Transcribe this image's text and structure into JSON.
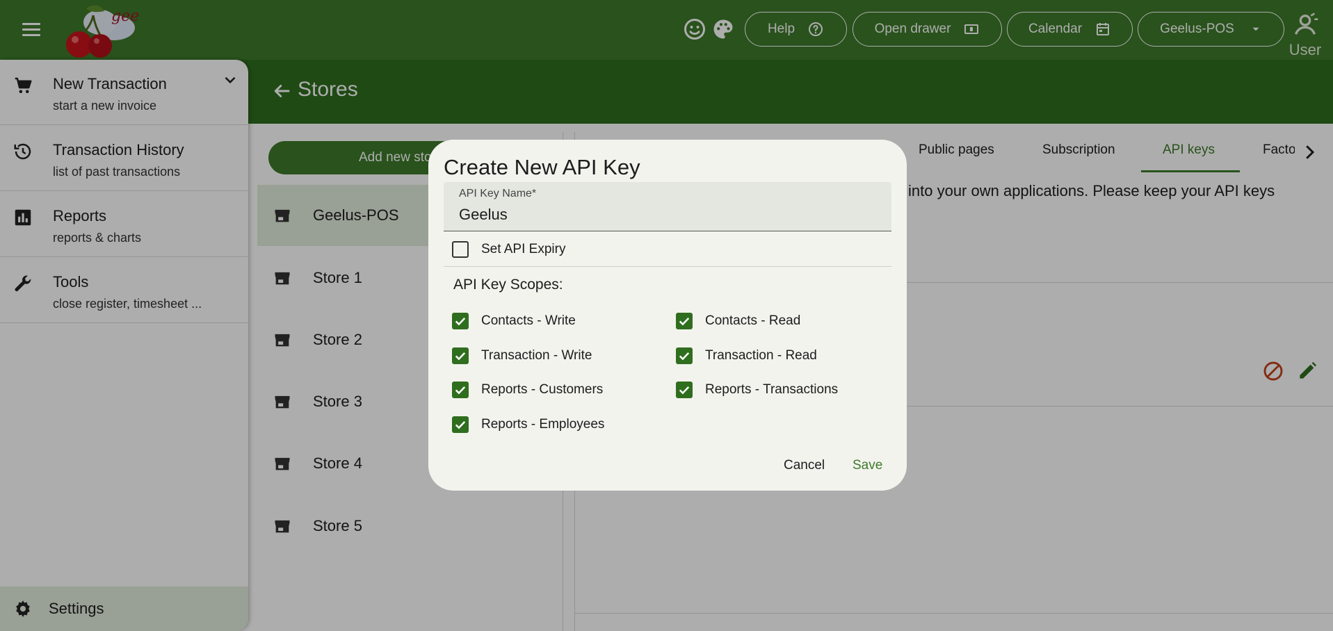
{
  "topbar": {
    "logo_text": "geelus",
    "help_label": "Help",
    "open_drawer_label": "Open drawer",
    "calendar_label": "Calendar",
    "store_select_label": "Geelus-POS",
    "user_label": "User"
  },
  "page": {
    "title": "Stores"
  },
  "drawer": {
    "items": [
      {
        "title": "New Transaction",
        "subtitle": "start a new invoice"
      },
      {
        "title": "Transaction History",
        "subtitle": "list of past transactions"
      },
      {
        "title": "Reports",
        "subtitle": "reports & charts"
      },
      {
        "title": "Tools",
        "subtitle": "close register, timesheet ..."
      }
    ],
    "settings_label": "Settings"
  },
  "stores": {
    "add_button_label": "Add new sto",
    "items": [
      "Geelus-POS",
      "Store 1",
      "Store 2",
      "Store 3",
      "Store 4",
      "Store 5"
    ],
    "selected": "Geelus-POS"
  },
  "detail": {
    "tabs": [
      "Public pages",
      "Subscription",
      "API keys",
      "Facto"
    ],
    "active_tab": "API keys",
    "description_fragment": "into your own applications. Please keep your API keys"
  },
  "dialog": {
    "title": "Create New API Key",
    "name_field": {
      "label": "API Key Name*",
      "value": "Geelus"
    },
    "expiry_label": "Set API Expiry",
    "expiry_checked": false,
    "scopes_title": "API Key Scopes:",
    "scopes": [
      {
        "label": "Contacts - Write",
        "checked": true
      },
      {
        "label": "Contacts - Read",
        "checked": true
      },
      {
        "label": "Transaction - Write",
        "checked": true
      },
      {
        "label": "Transaction - Read",
        "checked": true
      },
      {
        "label": "Reports - Customers",
        "checked": true
      },
      {
        "label": "Reports - Transactions",
        "checked": true
      },
      {
        "label": "Reports - Employees",
        "checked": true
      }
    ],
    "cancel_label": "Cancel",
    "save_label": "Save"
  },
  "colors": {
    "primary": "#3d7a2a",
    "primary_dark": "#2f6e1e",
    "dialog_bg": "#f3f3ee",
    "danger": "#c0431b"
  }
}
